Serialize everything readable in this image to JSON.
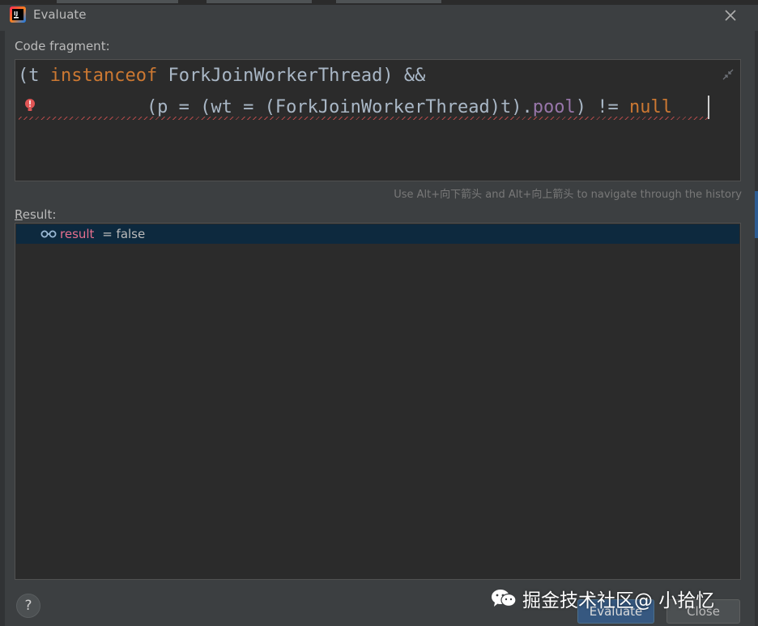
{
  "window": {
    "title": "Evaluate"
  },
  "icons": {
    "app": "intellij-idea-icon",
    "close": "close-icon",
    "error": "error-bulb-icon",
    "collapse": "collapse-icon",
    "result_var": "glasses-icon",
    "watermark": "wechat-logo-icon"
  },
  "code_fragment": {
    "label_first_letter": "C",
    "label_rest": "ode fragment:",
    "line1": {
      "open": "(t ",
      "keyword": "instanceof",
      "rest": " ForkJoinWorkerThread) &&"
    },
    "line2": {
      "lead": "            (p = (wt = (ForkJoinWorkerThread)t).",
      "field": "pool",
      "mid": ") != ",
      "keyword": "null"
    }
  },
  "history_hint": "Use Alt+向下箭头 and Alt+向上箭头 to navigate through the history",
  "result": {
    "label_first_letter": "R",
    "label_rest": "esult:",
    "var_name": "result",
    "separator": " = ",
    "value": "false"
  },
  "buttons": {
    "help": "?",
    "evaluate": "Evaluate",
    "close": "Close"
  },
  "watermark": {
    "text": "掘金技术社区@ 小拾忆"
  },
  "colors": {
    "background": "#3c3f41",
    "editor_bg": "#2b2b2b",
    "keyword": "#cc7832",
    "field": "#9876aa",
    "code_text": "#a9b7c6",
    "result_selection": "#0d293e",
    "var_name": "#e66f8e",
    "primary_button": "#365880"
  }
}
